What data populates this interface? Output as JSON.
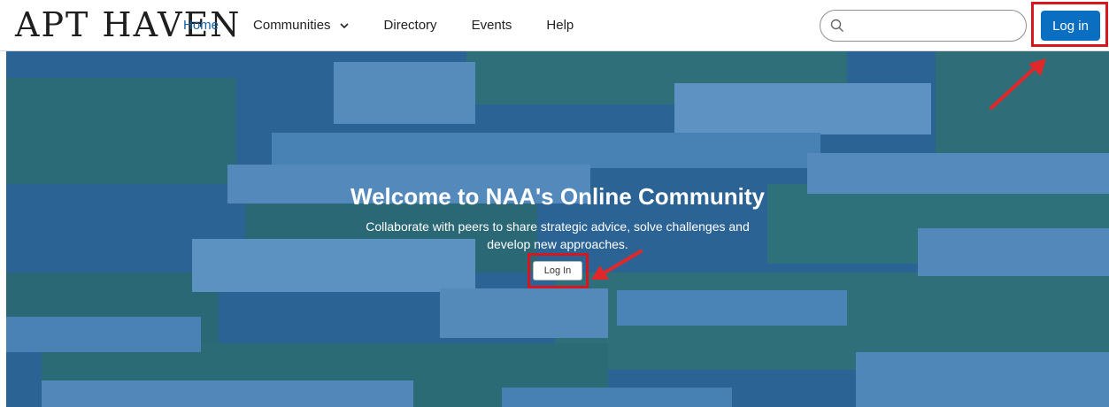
{
  "header": {
    "logo_text": "APT HAVEN",
    "nav": [
      {
        "label": "Home"
      },
      {
        "label": "Communities"
      },
      {
        "label": "Directory"
      },
      {
        "label": "Events"
      },
      {
        "label": "Help"
      }
    ],
    "search_placeholder": "",
    "login_label": "Log in"
  },
  "hero": {
    "title": "Welcome to NAA's Online Community",
    "subtitle": "Collaborate with peers to share strategic advice, solve challenges and develop new approaches.",
    "login_label": "Log In"
  },
  "colors": {
    "brand_blue": "#0b6fc1",
    "active_nav": "#1462a8",
    "highlight_red": "#d6171f",
    "hero_tint": "#2f6aa3"
  },
  "icons": {
    "search": "search-icon",
    "chevron": "chevron-down-icon",
    "annotation": "red-arrow-icon"
  }
}
